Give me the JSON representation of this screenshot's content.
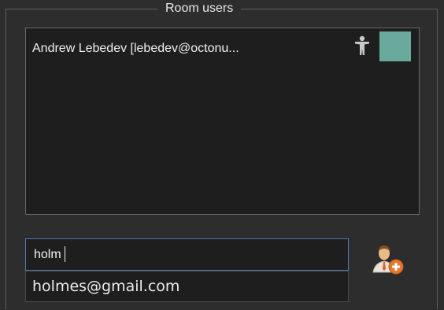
{
  "room_users": {
    "title": "Room users",
    "users": [
      {
        "display": "Andrew Lebedev  [lebedev@octonu...",
        "role_icon": "person-standing-icon",
        "color": "#6aaa9d"
      }
    ]
  },
  "search": {
    "value": "holm",
    "suggestions": [
      "holmes@gmail.com"
    ]
  },
  "add_user_button": {
    "icon": "add-user-icon"
  }
}
